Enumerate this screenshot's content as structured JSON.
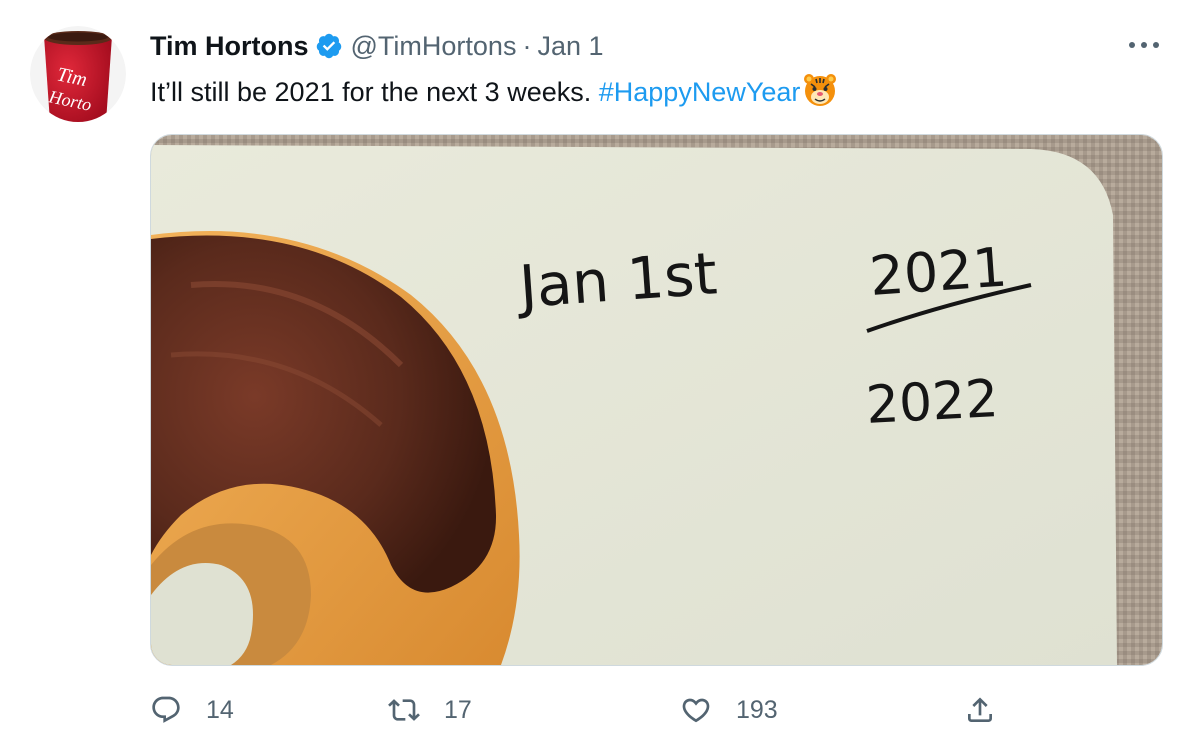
{
  "tweet": {
    "author_name": "Tim Hortons",
    "handle": "@TimHortons",
    "separator": "·",
    "date": "Jan 1",
    "text_main": "It’ll still be 2021 for the next 3 weeks.",
    "hashtag": "#HappyNewYear",
    "emoji": "tiger-face-emoji",
    "more_glyph": "•••"
  },
  "avatar": {
    "logo_text_line1": "Tim",
    "logo_text_line2": "Hortons"
  },
  "media": {
    "note_line1": "Jan 1st",
    "note_crossed_year": "2021",
    "note_new_year": "2022"
  },
  "actions": {
    "reply_count": "14",
    "retweet_count": "17",
    "like_count": "193"
  },
  "colors": {
    "accent": "#1d9bf0",
    "muted": "#536471",
    "brand_red": "#c8102e"
  }
}
